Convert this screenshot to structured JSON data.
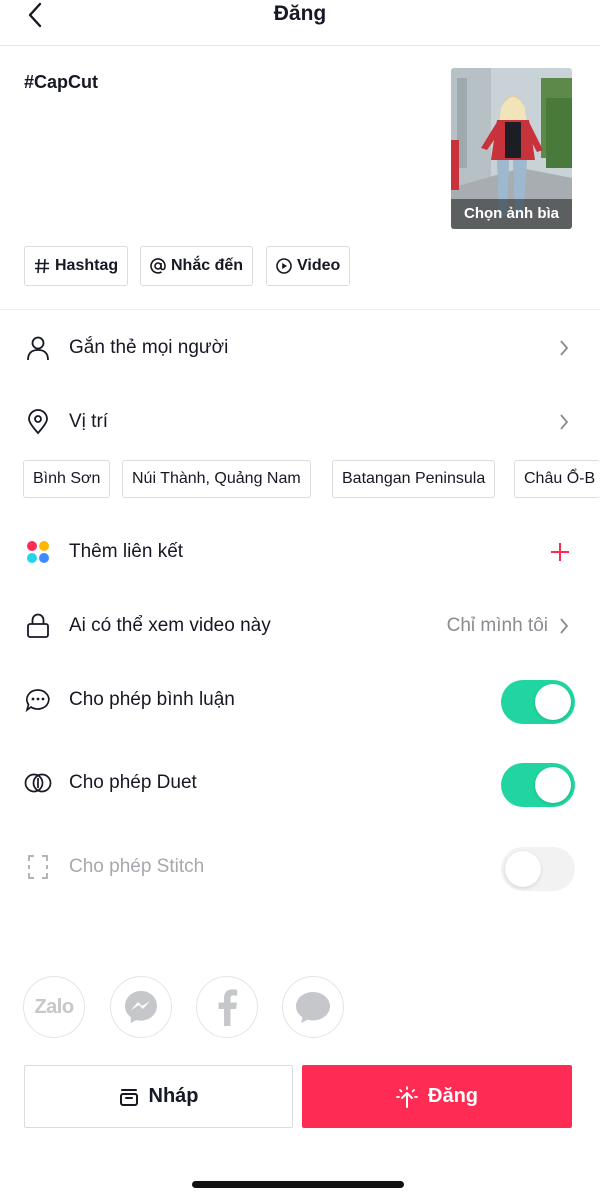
{
  "header": {
    "title": "Đăng",
    "back_icon": "chevron-left-icon"
  },
  "post": {
    "caption": "#CapCut",
    "cover_label": "Chọn ảnh bìa"
  },
  "chips": [
    {
      "label": "Hashtag",
      "icon": "hash-icon"
    },
    {
      "label": "Nhắc đến",
      "icon": "at-icon"
    },
    {
      "label": "Video",
      "icon": "play-circle-icon"
    }
  ],
  "settings": {
    "tag_people": {
      "label": "Gắn thẻ mọi người",
      "icon": "person-icon"
    },
    "location": {
      "label": "Vị trí",
      "icon": "location-pin-icon"
    },
    "add_link": {
      "label": "Thêm liên kết",
      "icon": "colorful-dots-icon"
    },
    "privacy": {
      "label": "Ai có thể xem video này",
      "value": "Chỉ mình tôi",
      "icon": "lock-icon"
    },
    "allow_comments": {
      "label": "Cho phép bình luận",
      "enabled": true,
      "icon": "comment-icon"
    },
    "allow_duet": {
      "label": "Cho phép Duet",
      "enabled": true,
      "icon": "duet-icon"
    },
    "allow_stitch": {
      "label": "Cho phép Stitch",
      "enabled": false,
      "icon": "stitch-icon"
    }
  },
  "location_suggestions": [
    "Bình Sơn",
    "Núi Thành, Quảng Nam",
    "Batangan Peninsula",
    "Châu Ổ-B"
  ],
  "share_targets": [
    {
      "name": "Zalo",
      "label": "Zalo",
      "icon": "zalo-icon"
    },
    {
      "name": "Messenger",
      "icon": "messenger-icon"
    },
    {
      "name": "Facebook",
      "icon": "facebook-icon"
    },
    {
      "name": "Message",
      "icon": "chat-bubble-icon"
    }
  ],
  "actions": {
    "draft_label": "Nháp",
    "post_label": "Đăng"
  },
  "colors": {
    "accent": "#fe2c55",
    "toggle_on": "#20d5a0",
    "text": "#161823",
    "muted": "#8a8b91"
  }
}
